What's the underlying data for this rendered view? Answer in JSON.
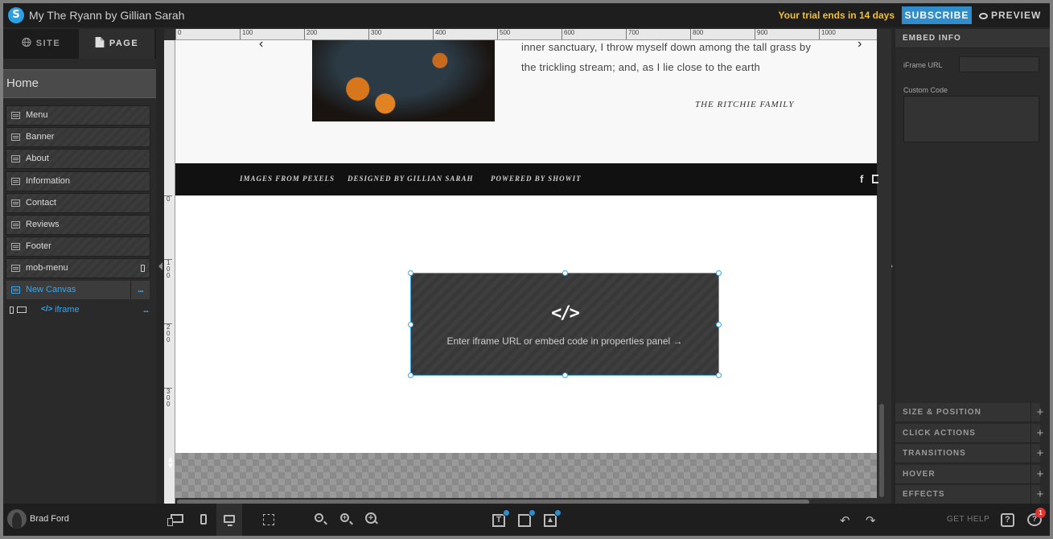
{
  "topbar": {
    "title": "My The Ryann by Gillian Sarah",
    "trial_text": "Your trial ends in 14 days",
    "subscribe_label": "SUBSCRIBE",
    "preview_label": "PREVIEW"
  },
  "left_panel": {
    "tabs": [
      {
        "label": "SITE",
        "icon": "globe-icon"
      },
      {
        "label": "PAGE",
        "icon": "page-icon"
      }
    ],
    "active_tab": "PAGE",
    "page_name": "Home",
    "canvases": [
      {
        "label": "Menu"
      },
      {
        "label": "Banner"
      },
      {
        "label": "About"
      },
      {
        "label": "Information"
      },
      {
        "label": "Contact"
      },
      {
        "label": "Reviews"
      },
      {
        "label": "Footer"
      },
      {
        "label": "mob-menu"
      },
      {
        "label": "New Canvas",
        "more": "..."
      }
    ],
    "selected_canvas": "New Canvas",
    "element": {
      "label": "iframe",
      "code_glyph": "</>",
      "more": "..."
    }
  },
  "canvas": {
    "ruler_h": [
      "0",
      "100",
      "200",
      "300",
      "400",
      "500",
      "600",
      "700",
      "800",
      "900",
      "1000"
    ],
    "ruler_v": [
      "0",
      "100",
      "200",
      "300"
    ],
    "testimonial_text": "inner sanctuary, I throw myself down among the tall grass by the trickling stream; and, as I lie close to the earth",
    "testimonial_author": "THE RITCHIE FAMILY",
    "footer_credits": [
      "IMAGES FROM PEXELS",
      "DESIGNED BY GILLIAN SARAH",
      "POWERED BY SHOWIT"
    ],
    "embed_icon": "</>",
    "embed_hint": "Enter iframe URL or embed code in properties panel →"
  },
  "right_panel": {
    "header": "EMBED INFO",
    "iframe_url_label": "iFrame URL",
    "iframe_url_value": "",
    "custom_code_label": "Custom Code",
    "custom_code_value": "",
    "sections": [
      "SIZE & POSITION",
      "CLICK ACTIONS",
      "TRANSITIONS",
      "HOVER",
      "EFFECTS"
    ]
  },
  "bottombar": {
    "user_name": "Brad Ford",
    "get_help_label": "GET HELP",
    "notification_count": "1"
  },
  "colors": {
    "accent": "#2f8dcc",
    "selection": "#3aa5e6",
    "trial": "#f3c127",
    "badge": "#e0322e"
  }
}
